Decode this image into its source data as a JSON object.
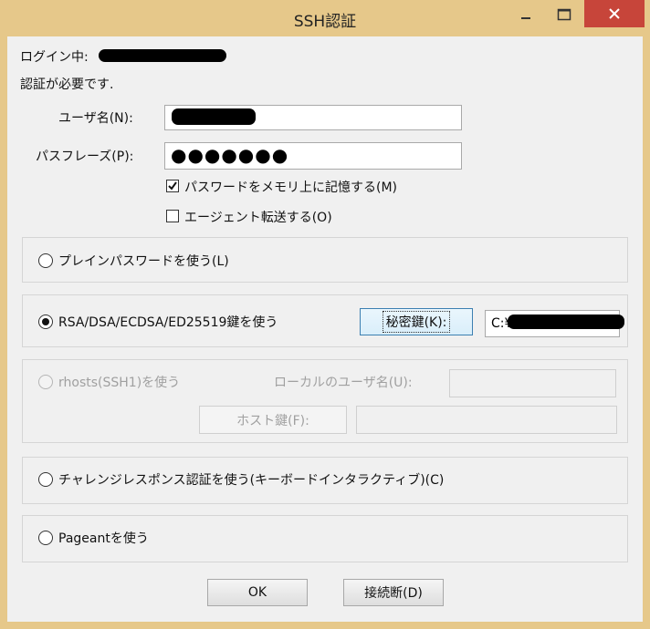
{
  "window": {
    "title": "SSH認証",
    "accent_color": "#e6c88a",
    "close_color": "#c7453a"
  },
  "header": {
    "login_prefix": "ログイン中:",
    "auth_required": "認証が必要です."
  },
  "fields": {
    "username_label": "ユーザ名(N):",
    "username_value": "",
    "passphrase_label": "パスフレーズ(P):",
    "passphrase_value": "●●●●●●●",
    "remember_password_label": "パスワードをメモリ上に記憶する(M)",
    "remember_password_checked": true,
    "agent_forward_label": "エージェント転送する(O)",
    "agent_forward_checked": false
  },
  "methods": {
    "plain_password": {
      "label": "プレインパスワードを使う(L)",
      "selected": false
    },
    "rsa_key": {
      "label": "RSA/DSA/ECDSA/ED25519鍵を使う",
      "selected": true,
      "private_key_button": "秘密鍵(K):",
      "key_path_prefix": "C:¥"
    },
    "rhosts": {
      "label": "rhosts(SSH1)を使う",
      "selected": false,
      "local_user_label": "ローカルのユーザ名(U):",
      "host_key_button": "ホスト鍵(F):"
    },
    "challenge_response": {
      "label": "チャレンジレスポンス認証を使う(キーボードインタラクティブ)(C)",
      "selected": false
    },
    "pageant": {
      "label": "Pageantを使う",
      "selected": false
    }
  },
  "buttons": {
    "ok": "OK",
    "disconnect": "接続断(D)"
  }
}
